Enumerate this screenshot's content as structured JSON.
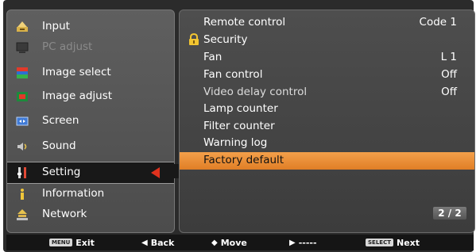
{
  "sidebar": {
    "items": [
      {
        "label": "Input",
        "icon": "input-icon",
        "state": "normal"
      },
      {
        "label": "PC adjust",
        "icon": "pc-adjust-icon",
        "state": "disabled"
      },
      {
        "label": "Image select",
        "icon": "image-select-icon",
        "state": "normal"
      },
      {
        "label": "Image adjust",
        "icon": "image-adjust-icon",
        "state": "normal"
      },
      {
        "label": "Screen",
        "icon": "screen-icon",
        "state": "normal"
      },
      {
        "label": "Sound",
        "icon": "sound-icon",
        "state": "normal"
      },
      {
        "label": "Setting",
        "icon": "setting-icon",
        "state": "selected"
      },
      {
        "label": "Information",
        "icon": "information-icon",
        "state": "normal"
      },
      {
        "label": "Network",
        "icon": "network-icon",
        "state": "normal"
      }
    ]
  },
  "settings": {
    "rows": [
      {
        "label": "Remote control",
        "value": "Code 1"
      },
      {
        "label": "Security",
        "value": "",
        "icon": "lock-icon"
      },
      {
        "label": "Fan",
        "value": "L 1"
      },
      {
        "label": "Fan control",
        "value": "Off"
      },
      {
        "label": "Video delay control",
        "value": "Off"
      },
      {
        "label": "Lamp counter",
        "value": ""
      },
      {
        "label": "Filter counter",
        "value": ""
      },
      {
        "label": "Warning log",
        "value": ""
      },
      {
        "label": "Factory default",
        "value": "",
        "highlighted": true
      }
    ],
    "page_indicator": "2 / 2"
  },
  "footer": {
    "hints": [
      {
        "key": "MENU",
        "label": "Exit"
      },
      {
        "glyph": "◀",
        "label": "Back"
      },
      {
        "glyph": "◆",
        "label": "Move"
      },
      {
        "glyph": "▶",
        "label": "-----"
      },
      {
        "key": "SELECT",
        "label": "Next"
      }
    ]
  },
  "colors": {
    "highlight": "#e8892f",
    "selection_arrow": "#e0321e",
    "panel_bg": "#4a4a4a",
    "bar_bg": "#151515"
  }
}
